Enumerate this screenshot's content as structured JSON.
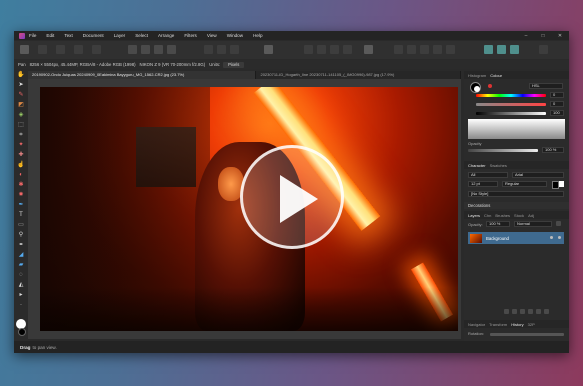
{
  "menu": [
    "File",
    "Edit",
    "Text",
    "Document",
    "Layer",
    "Select",
    "Arrange",
    "Filters",
    "View",
    "Window",
    "Help"
  ],
  "window_controls": [
    "–",
    "□",
    "✕"
  ],
  "context_bar": {
    "label": "Pan",
    "info": "8256 × 5504px, 45.44MP, RGBA/8 - Adobe RGB (1998)",
    "camera": "NIKON Z 9 (VR 70-200mm f/2.8G)",
    "units_label": "Units:",
    "units_value": "Pixels"
  },
  "tabs": [
    {
      "label": "20190902-Ondo Juiquas 20240909_0Eakimina Bayyguru_MG_1562-CR2.jpg (23.7%)",
      "active": true
    },
    {
      "label": "20230711-ID_Hogarth_line 20230711-141105_(_IMG0996)-987.jpg (17.9%)",
      "active": false
    }
  ],
  "tools": [
    "hand",
    "move",
    "paint-brush",
    "eraser",
    "flood-fill",
    "selection",
    "crop",
    "clone",
    "healing",
    "smudge",
    "dodge",
    "burn",
    "sponge",
    "pen",
    "text",
    "shape",
    "eyedropper",
    "zoom",
    "gradient",
    "transparency",
    "blur",
    "sharpen",
    "liquify",
    "color-picker",
    "node",
    "magnifier"
  ],
  "panel": {
    "top_tabs": [
      "Histogram",
      "Colour"
    ],
    "color_mode": "HSL",
    "color_values": [
      "0",
      "0",
      "100"
    ],
    "opacity_label": "Opacity",
    "opacity_value": "100 %",
    "char_tabs": [
      "Character",
      "Swatches"
    ],
    "font_all": "All",
    "font_family": "Arial",
    "font_size": "12 pt",
    "font_style": "Regular",
    "no_style": "[No Style]",
    "decorations": "Decorations",
    "layer_tabs": [
      "Layers",
      "Chn",
      "Brushes",
      "Stock",
      "Adj"
    ],
    "layer_opacity_label": "Opacity:",
    "layer_opacity": "100 %",
    "blend_mode": "Normal",
    "layer_name": "Background",
    "nav_tabs": [
      "Navigator",
      "Transform",
      "History",
      "32P"
    ],
    "nav_label": "Rotation:"
  },
  "status": {
    "bold": "Drag",
    "rest": "to pan view."
  },
  "video_overlay": {
    "icon": "play-icon"
  },
  "colors": {
    "accent": "#3f6a8f",
    "window_bg": "#2a2a2a"
  }
}
